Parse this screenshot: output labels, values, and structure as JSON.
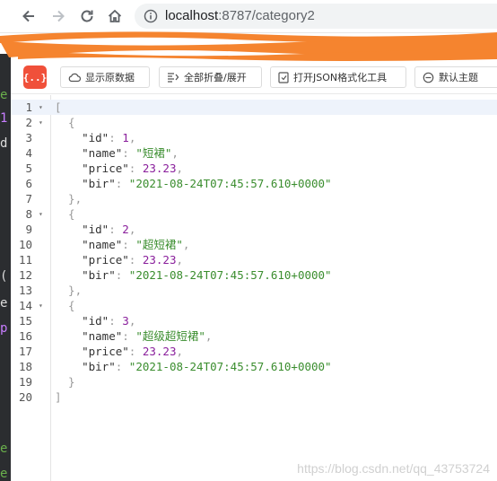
{
  "browser": {
    "url_host": "localhost",
    "url_rest": ":8787/category2"
  },
  "toolbar": {
    "logo": "{..}",
    "buttons": [
      {
        "label": "显示原数据",
        "icon": "cloud-icon"
      },
      {
        "label": "全部折叠/展开",
        "icon": "collapse-icon"
      },
      {
        "label": "打开JSON格式化工具",
        "icon": "tool-icon"
      },
      {
        "label": "默认主题",
        "icon": "theme-icon"
      }
    ]
  },
  "lines": [
    {
      "n": "1",
      "fold": "▾",
      "segs": [
        {
          "c": "p",
          "t": "["
        }
      ]
    },
    {
      "n": "2",
      "fold": "▾",
      "segs": [
        {
          "c": "p",
          "t": "  {"
        }
      ]
    },
    {
      "n": "3",
      "fold": "",
      "segs": [
        {
          "c": "k",
          "t": "    \"id\""
        },
        {
          "c": "p",
          "t": ": "
        },
        {
          "c": "n",
          "t": "1"
        },
        {
          "c": "p",
          "t": ","
        }
      ]
    },
    {
      "n": "4",
      "fold": "",
      "segs": [
        {
          "c": "k",
          "t": "    \"name\""
        },
        {
          "c": "p",
          "t": ": "
        },
        {
          "c": "s",
          "t": "\"短裙\""
        },
        {
          "c": "p",
          "t": ","
        }
      ]
    },
    {
      "n": "5",
      "fold": "",
      "segs": [
        {
          "c": "k",
          "t": "    \"price\""
        },
        {
          "c": "p",
          "t": ": "
        },
        {
          "c": "n",
          "t": "23.23"
        },
        {
          "c": "p",
          "t": ","
        }
      ]
    },
    {
      "n": "6",
      "fold": "",
      "segs": [
        {
          "c": "k",
          "t": "    \"bir\""
        },
        {
          "c": "p",
          "t": ": "
        },
        {
          "c": "s",
          "t": "\"2021-08-24T07:45:57.610+0000\""
        }
      ]
    },
    {
      "n": "7",
      "fold": "",
      "segs": [
        {
          "c": "p",
          "t": "  },"
        }
      ]
    },
    {
      "n": "8",
      "fold": "▾",
      "segs": [
        {
          "c": "p",
          "t": "  {"
        }
      ]
    },
    {
      "n": "9",
      "fold": "",
      "segs": [
        {
          "c": "k",
          "t": "    \"id\""
        },
        {
          "c": "p",
          "t": ": "
        },
        {
          "c": "n",
          "t": "2"
        },
        {
          "c": "p",
          "t": ","
        }
      ]
    },
    {
      "n": "10",
      "fold": "",
      "segs": [
        {
          "c": "k",
          "t": "    \"name\""
        },
        {
          "c": "p",
          "t": ": "
        },
        {
          "c": "s",
          "t": "\"超短裙\""
        },
        {
          "c": "p",
          "t": ","
        }
      ]
    },
    {
      "n": "11",
      "fold": "",
      "segs": [
        {
          "c": "k",
          "t": "    \"price\""
        },
        {
          "c": "p",
          "t": ": "
        },
        {
          "c": "n",
          "t": "23.23"
        },
        {
          "c": "p",
          "t": ","
        }
      ]
    },
    {
      "n": "12",
      "fold": "",
      "segs": [
        {
          "c": "k",
          "t": "    \"bir\""
        },
        {
          "c": "p",
          "t": ": "
        },
        {
          "c": "s",
          "t": "\"2021-08-24T07:45:57.610+0000\""
        }
      ]
    },
    {
      "n": "13",
      "fold": "",
      "segs": [
        {
          "c": "p",
          "t": "  },"
        }
      ]
    },
    {
      "n": "14",
      "fold": "▾",
      "segs": [
        {
          "c": "p",
          "t": "  {"
        }
      ]
    },
    {
      "n": "15",
      "fold": "",
      "segs": [
        {
          "c": "k",
          "t": "    \"id\""
        },
        {
          "c": "p",
          "t": ": "
        },
        {
          "c": "n",
          "t": "3"
        },
        {
          "c": "p",
          "t": ","
        }
      ]
    },
    {
      "n": "16",
      "fold": "",
      "segs": [
        {
          "c": "k",
          "t": "    \"name\""
        },
        {
          "c": "p",
          "t": ": "
        },
        {
          "c": "s",
          "t": "\"超级超短裙\""
        },
        {
          "c": "p",
          "t": ","
        }
      ]
    },
    {
      "n": "17",
      "fold": "",
      "segs": [
        {
          "c": "k",
          "t": "    \"price\""
        },
        {
          "c": "p",
          "t": ": "
        },
        {
          "c": "n",
          "t": "23.23"
        },
        {
          "c": "p",
          "t": ","
        }
      ]
    },
    {
      "n": "18",
      "fold": "",
      "segs": [
        {
          "c": "k",
          "t": "    \"bir\""
        },
        {
          "c": "p",
          "t": ": "
        },
        {
          "c": "s",
          "t": "\"2021-08-24T07:45:57.610+0000\""
        }
      ]
    },
    {
      "n": "19",
      "fold": "",
      "segs": [
        {
          "c": "p",
          "t": "  }"
        }
      ]
    },
    {
      "n": "20",
      "fold": "",
      "segs": [
        {
          "c": "p",
          "t": "]"
        }
      ]
    }
  ],
  "watermark": "https://blog.csdn.net/qq_43753724",
  "colors": {
    "accent": "#f0503a",
    "redaction": "#f5842f",
    "number": "#8a1f9c",
    "string": "#3a8d2e"
  }
}
